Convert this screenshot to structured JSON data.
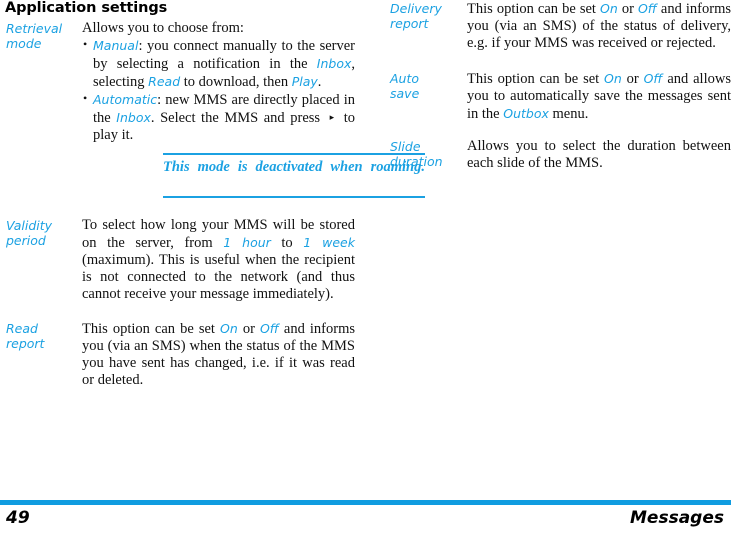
{
  "document": {
    "title": "Application settings",
    "accent_color": "#1BA1E2",
    "footer_rule_color": "#109CE0",
    "text_color": "#111111"
  },
  "left_column": {
    "retrieval": {
      "label_line1": "Retrieval",
      "label_line2": "mode",
      "lead": "Allows you to choose from:",
      "bullet1": {
        "term": "Manual",
        "text_after": ": you connect manually to the server by selecting a notification in the ",
        "ui_inbox": "Inbox",
        "text_mid": ", selecting ",
        "ui_read": "Read",
        "text_mid2": " to download, then ",
        "ui_play": "Play",
        "text_end": "."
      },
      "bullet2": {
        "term": "Automatic",
        "text_after": ": new MMS are directly placed in the ",
        "ui_inbox": "Inbox",
        "text_mid": ". Select the MMS and press ",
        "key_glyph": "play-key-icon",
        "text_end": " to play it."
      },
      "note": "This mode is deactivated when roaming."
    },
    "validity": {
      "label_line1": "Validity",
      "label_line2": "period",
      "text_start": "To select how long your MMS will be stored on the server, from ",
      "ui_one_hour": "1 hour",
      "text_mid": " to ",
      "ui_one_week": "1 week",
      "text_end": " (maximum). This is useful when the recipient is not connected to the network (and thus cannot receive your message immediately)."
    },
    "read_report": {
      "label_line1": "Read",
      "label_line2": "report",
      "text_start": "This option can be set ",
      "ui_on": "On",
      "text_or": " or ",
      "ui_off": "Off",
      "text_end": " and informs you (via an SMS) when the status of the MMS you have sent has changed, i.e. if it was read or deleted."
    }
  },
  "right_column": {
    "delivery_report": {
      "label_line1": "Delivery",
      "label_line2": "report",
      "text_start": "This option can be set ",
      "ui_on": "On",
      "text_or": " or ",
      "ui_off": "Off",
      "text_end": " and informs you (via an SMS) of the status of delivery, e.g. if your MMS was received or rejected."
    },
    "auto_save": {
      "label_line1": "Auto",
      "label_line2": "save",
      "text_start": "This option can be set ",
      "ui_on": "On",
      "text_or": " or ",
      "ui_off": "Off",
      "text_mid": " and allows you to automatically save the messages sent in the ",
      "ui_outbox": "Outbox",
      "text_end": " menu."
    },
    "slide_duration": {
      "label_line1": "Slide",
      "label_line2": "duration",
      "text": "Allows you to select the duration between each slide of the MMS."
    }
  },
  "footer": {
    "page_number": "49",
    "section": "Messages"
  }
}
